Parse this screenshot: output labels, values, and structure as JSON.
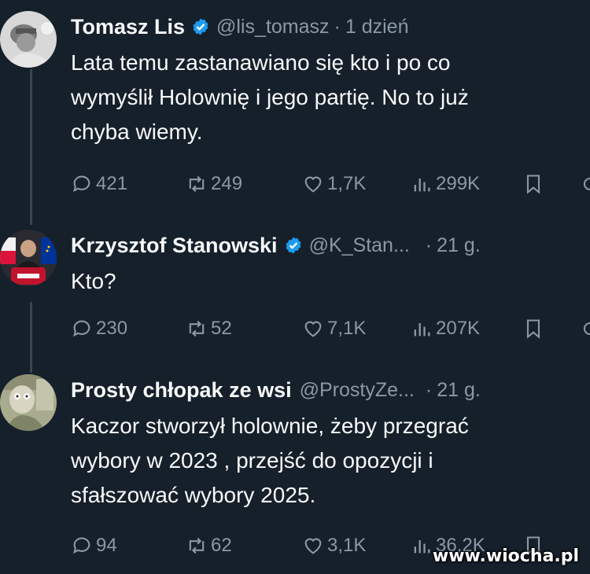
{
  "tweets": [
    {
      "name": "Tomasz Lis",
      "handle": "@lis_tomasz",
      "separator": "·",
      "time": "1 dzień",
      "text_lines": [
        "Lata temu zastanawiano się kto i po co",
        "wymyślił Holownię i jego partię. No to już",
        "chyba wiemy."
      ],
      "replies": "421",
      "reposts": "249",
      "likes": "1,7K",
      "views": "299K"
    },
    {
      "name": "Krzysztof Stanowski",
      "handle": "@K_Stan...",
      "separator": "·",
      "time": "21 g.",
      "text_lines": [
        "Kto?"
      ],
      "replies": "230",
      "reposts": "52",
      "likes": "7,1K",
      "views": "207K"
    },
    {
      "name": "Prosty chłopak ze wsi",
      "handle": "@ProstyZe...",
      "separator": "·",
      "time": "21 g.",
      "text_lines": [
        "Kaczor stworzył holownie, żeby przegrać",
        "wybory w 2023 , przejść do opozycji i",
        "sfałszować wybory 2025."
      ],
      "replies": "94",
      "reposts": "62",
      "likes": "3,1K",
      "views": "36,2K"
    }
  ],
  "watermark": "www.wiocha.pl",
  "colors": {
    "background": "#15202b",
    "muted": "#8b98a5",
    "verified": "#1d9bf0",
    "thread_line": "#38444d"
  },
  "icons": [
    "reply-icon",
    "repost-icon",
    "like-icon",
    "views-icon",
    "bookmark-icon",
    "share-icon",
    "verified-icon"
  ]
}
